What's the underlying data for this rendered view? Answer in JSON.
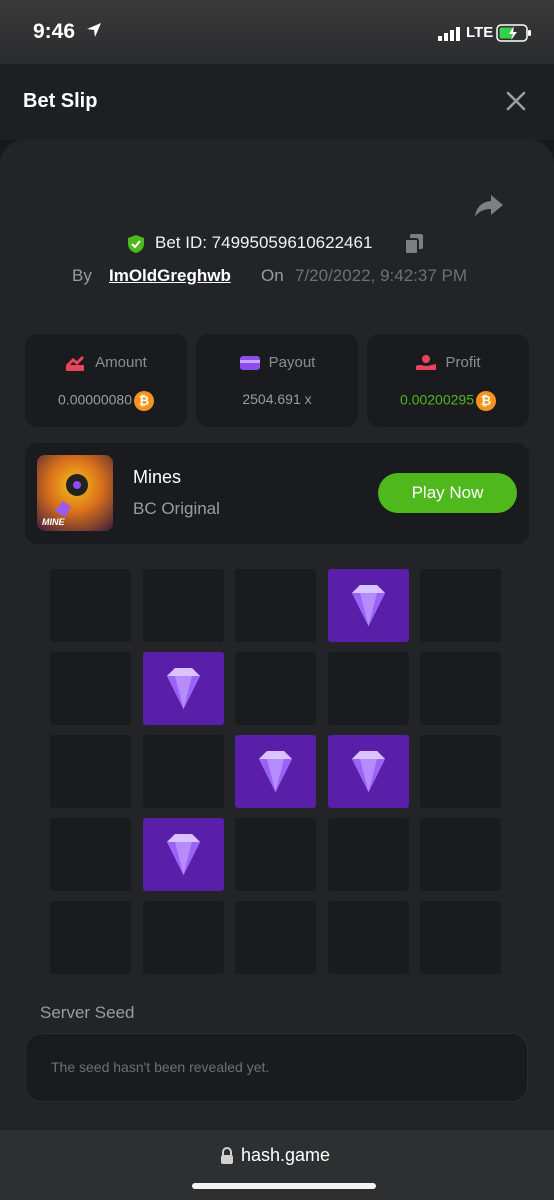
{
  "status_bar": {
    "time": "9:46",
    "network": "LTE"
  },
  "header": {
    "title": "Bet Slip"
  },
  "bet": {
    "id_text": "Bet ID: 74995059610622461",
    "by_label": "By",
    "user": "ImOldGreghwb",
    "on_label": "On",
    "date": "7/20/2022, 9:42:37 PM"
  },
  "stats": [
    {
      "label": "Amount",
      "value": "0.00000080",
      "color": "#9a9ca3"
    },
    {
      "label": "Payout",
      "value": "2504.691 x",
      "color": "#9a9ca3"
    },
    {
      "label": "Profit",
      "value": "0.00200295",
      "color": "#4fb81c"
    }
  ],
  "game": {
    "name": "Mines",
    "provider": "BC Original",
    "play_label": "Play Now",
    "thumb_label": "MINE"
  },
  "board": {
    "rows": 5,
    "cols": 5,
    "gems": [
      [
        0,
        3
      ],
      [
        1,
        1
      ],
      [
        2,
        2
      ],
      [
        2,
        3
      ],
      [
        3,
        1
      ]
    ]
  },
  "seed": {
    "label": "Server Seed",
    "value": "The seed hasn't been revealed yet."
  },
  "browser": {
    "url": "hash.game"
  },
  "colors": {
    "accent_green": "#4fb81c",
    "gem_tile": "#5a1fa8",
    "btc": "#f7931a"
  }
}
